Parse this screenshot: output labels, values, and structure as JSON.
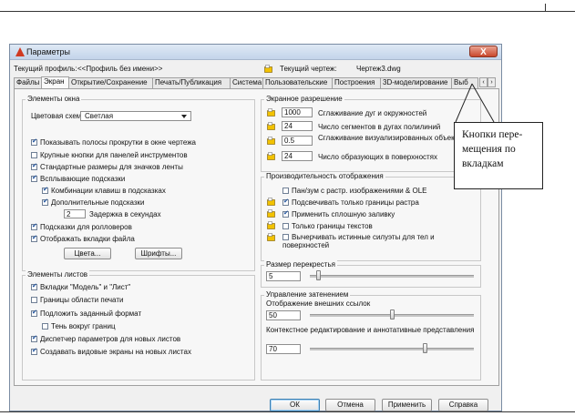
{
  "window": {
    "title": "Параметры",
    "close_label": "X"
  },
  "profile": {
    "current_profile_label": "Текущий профиль:",
    "current_profile_value": "<<Профиль без имени>>",
    "current_drawing_label": "Текущий чертеж:",
    "current_drawing_value": "Чертеж3.dwg"
  },
  "tabs": [
    {
      "label": "Файлы"
    },
    {
      "label": "Экран"
    },
    {
      "label": "Открытие/Сохранение"
    },
    {
      "label": "Печать/Публикация"
    },
    {
      "label": "Система"
    },
    {
      "label": "Пользовательские"
    },
    {
      "label": "Построения"
    },
    {
      "label": "3D-моделирование"
    },
    {
      "label": "Выб"
    }
  ],
  "active_tab": "Экран",
  "tab_scroll": {
    "prev": "‹",
    "next": "›"
  },
  "window_elements": {
    "title": "Элементы окна",
    "color_scheme_label": "Цветовая схема:",
    "color_scheme_value": "Светлая",
    "options": [
      {
        "label": "Показывать полосы прокрутки в окне чертежа",
        "checked": true
      },
      {
        "label": "Крупные кнопки для панелей инструментов",
        "checked": false
      },
      {
        "label": "Стандартные размеры для значков ленты",
        "checked": true
      },
      {
        "label": "Всплывающие подсказки",
        "checked": true
      },
      {
        "label": "Комбинации клавиш в подсказках",
        "checked": true
      },
      {
        "label": "Дополнительные подсказки",
        "checked": true
      },
      {
        "label": "Подсказки для ролловеров",
        "checked": true
      },
      {
        "label": "Отображать вкладки файла",
        "checked": true
      }
    ],
    "delay_value": "2",
    "delay_label": "Задержка в секундах",
    "colors_button": "Цвета...",
    "fonts_button": "Шрифты..."
  },
  "layout_elements": {
    "title": "Элементы листов",
    "options": [
      {
        "label": "Вкладки \"Модель\" и \"Лист\"",
        "checked": true
      },
      {
        "label": "Границы области печати",
        "checked": false
      },
      {
        "label": "Подложить заданный формат",
        "checked": true
      },
      {
        "label": "Тень вокруг границ",
        "checked": false
      },
      {
        "label": "Диспетчер параметров для новых листов",
        "checked": true
      },
      {
        "label": "Создавать видовые экраны на новых листах",
        "checked": true
      }
    ]
  },
  "resolution": {
    "title": "Экранное разрешение",
    "items": [
      {
        "value": "1000",
        "label": "Сглаживание дуг и окружностей"
      },
      {
        "value": "24",
        "label": "Число сегментов в дугах полилиний"
      },
      {
        "value": "0.5",
        "label": "Сглаживание визуализированных объектов"
      },
      {
        "value": "24",
        "label": "Число образующих в поверхностях"
      }
    ]
  },
  "performance": {
    "title": "Производительность отображения",
    "options": [
      {
        "label": "Пан/зум с растр. изображениями & OLE",
        "checked": false,
        "icon": false
      },
      {
        "label": "Подсвечивать только границы растра",
        "checked": true,
        "icon": true
      },
      {
        "label": "Применить сплошную заливку",
        "checked": true,
        "icon": true
      },
      {
        "label": "Только границы текстов",
        "checked": false,
        "icon": true
      },
      {
        "label": "Вычерчивать истинные силуэты для тел и поверхностей",
        "checked": false,
        "icon": true
      }
    ]
  },
  "crosshair": {
    "title": "Размер перекрестья",
    "value": "5",
    "fraction": 0.05
  },
  "fade": {
    "title": "Управление затенением",
    "xref_label": "Отображение внешних ссылок",
    "xref_value": "50",
    "xref_fraction": 0.5,
    "inplace_label": "Контекстное редактирование и аннотативные представления",
    "inplace_value": "70",
    "inplace_fraction": 0.7
  },
  "footer": {
    "ok": "ОК",
    "cancel": "Отмена",
    "apply": "Применить",
    "help": "Справка"
  },
  "callout": {
    "lines": [
      "Кнопки пере-",
      "мещения по",
      "вкладкам"
    ]
  },
  "colors": {
    "title_bar": "#c9d9ee",
    "close_button": "#c9472c",
    "checkbox_mark": "#1c4f9c",
    "panel_bg": "#f7f7f7"
  }
}
